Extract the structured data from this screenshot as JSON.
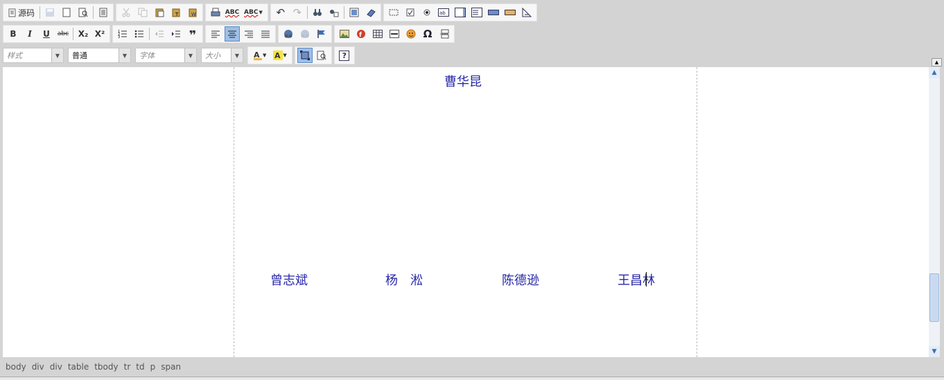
{
  "toolbar": {
    "source_label": "源码",
    "row3": {
      "style_placeholder": "样式",
      "format_value": "普通",
      "font_placeholder": "字体",
      "size_placeholder": "大小"
    },
    "buttons": {
      "bold": "B",
      "italic": "I",
      "underline": "U",
      "strike": "abc",
      "subscript": "X₂",
      "superscript": "X²",
      "spellcheck": "ABC",
      "help": "?"
    }
  },
  "content": {
    "top_name": "曹华昆",
    "names": [
      "曾志斌",
      "杨　淞",
      "陈德逊",
      "王昌林"
    ]
  },
  "statusbar": {
    "path": [
      "body",
      "div",
      "div",
      "table",
      "tbody",
      "tr",
      "td",
      "p",
      "span"
    ]
  }
}
